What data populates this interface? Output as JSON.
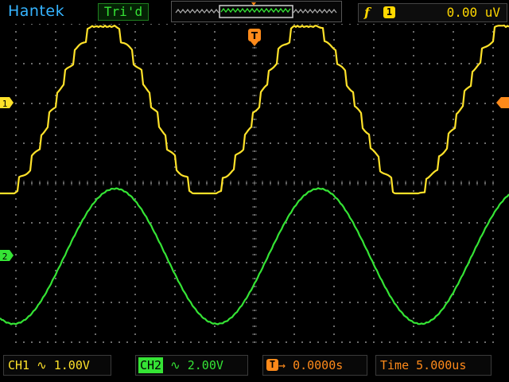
{
  "header": {
    "brand": "Hantek",
    "trigger_status": "Tri'd",
    "trigger_edge_symbol": "f",
    "trigger_channel": "1",
    "trigger_level": "0.00  uV"
  },
  "markers": {
    "ch1": "1",
    "ch2": "2",
    "trigger_time": "T"
  },
  "footer": {
    "ch1_label": "CH1",
    "ch1_coupling_icon": "ac-coupling-icon",
    "ch1_coupling_glyph": "∿",
    "ch1_scale": "1.00V",
    "ch2_label": "CH2",
    "ch2_coupling_icon": "ac-coupling-icon",
    "ch2_coupling_glyph": "∿",
    "ch2_scale": "2.00V",
    "trigger_pos_icon_text": "T",
    "trigger_pos_arrow": "→",
    "trigger_position": "0.0000s",
    "time_label": "Time",
    "time_scale": "5.000us"
  },
  "colors": {
    "ch1": "#ffe22a",
    "ch2": "#35e435",
    "trigger": "#ff8a1a",
    "brand": "#35b4ff",
    "grid": "#6b6b6b"
  },
  "chart_data": {
    "type": "line",
    "grid": true,
    "divisions": {
      "x": 12,
      "y": 8
    },
    "series": [
      {
        "name": "CH1",
        "waveform": "stepped-sine",
        "cycles_visible": 2.5
      },
      {
        "name": "CH2",
        "waveform": "sine",
        "cycles_visible": 2.5
      }
    ]
  }
}
